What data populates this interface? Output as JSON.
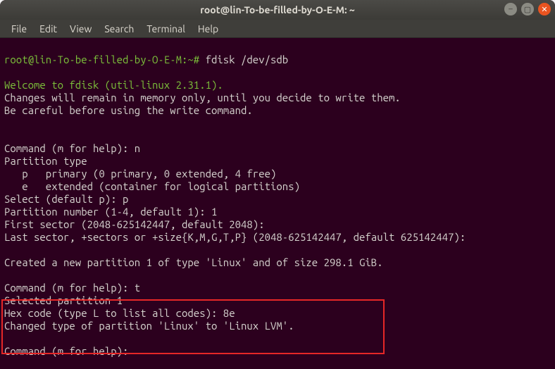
{
  "titlebar": {
    "title": "root@lin-To-be-filled-by-O-E-M: ~"
  },
  "window_controls": {
    "minimize": "–",
    "maximize": "▢",
    "close": "✕"
  },
  "menubar": {
    "file": "File",
    "edit": "Edit",
    "view": "View",
    "search": "Search",
    "terminal": "Terminal",
    "help": "Help"
  },
  "term": {
    "prompt1": "root@lin-To-be-filled-by-O-E-M:~# ",
    "cmd1": "fdisk /dev/sdb",
    "blank1": "",
    "welcome": "Welcome to fdisk (util-linux 2.31.1).",
    "line2": "Changes will remain in memory only, until you decide to write them.",
    "line3": "Be careful before using the write command.",
    "blank2": "",
    "blank3": "",
    "cmdhelp1": "Command (m for help): n",
    "ptype": "Partition type",
    "prim": "   p   primary (0 primary, 0 extended, 4 free)",
    "ext": "   e   extended (container for logical partitions)",
    "sel": "Select (default p): p",
    "pnum": "Partition number (1-4, default 1): 1",
    "fsec": "First sector (2048-625142447, default 2048):",
    "lsec": "Last sector, +sectors or +size{K,M,G,T,P} (2048-625142447, default 625142447):",
    "blank4": "",
    "created": "Created a new partition 1 of type 'Linux' and of size 298.1 GiB.",
    "blank5": "",
    "cmdhelp2": "Command (m for help): t",
    "selpart": "Selected partition 1",
    "hex": "Hex code (type L to list all codes): 8e",
    "changed": "Changed type of partition 'Linux' to 'Linux LVM'.",
    "blank6": "",
    "cmdhelp3": "Command (m for help): "
  }
}
